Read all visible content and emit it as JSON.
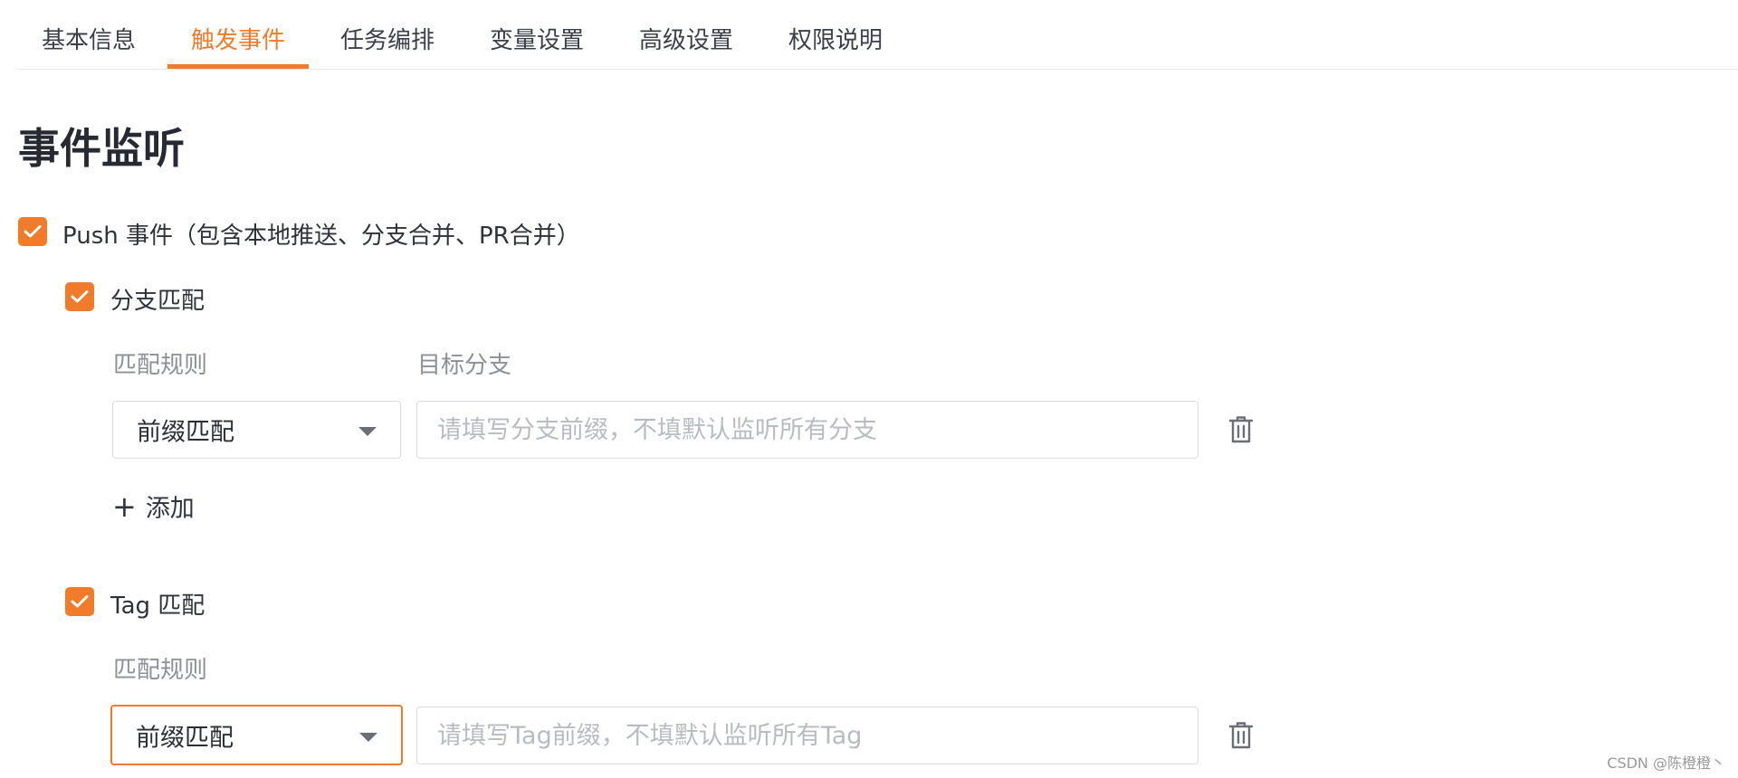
{
  "tabs": [
    {
      "label": "基本信息",
      "active": false
    },
    {
      "label": "触发事件",
      "active": true
    },
    {
      "label": "任务编排",
      "active": false
    },
    {
      "label": "变量设置",
      "active": false
    },
    {
      "label": "高级设置",
      "active": false
    },
    {
      "label": "权限说明",
      "active": false
    }
  ],
  "page_title": "事件监听",
  "push_event": {
    "checked": true,
    "label": "Push 事件（包含本地推送、分支合并、PR合并）"
  },
  "branch_match": {
    "checked": true,
    "label": "分支匹配",
    "rule_label": "匹配规则",
    "target_label": "目标分支",
    "rule_value": "前缀匹配",
    "input_value": "",
    "input_placeholder": "请填写分支前缀，不填默认监听所有分支",
    "add_label": "添加"
  },
  "tag_match": {
    "checked": true,
    "label": "Tag 匹配",
    "rule_label": "匹配规则",
    "rule_value": "前缀匹配",
    "input_value": "",
    "input_placeholder": "请填写Tag前缀，不填默认监听所有Tag"
  },
  "watermark": "CSDN @陈橙橙丶",
  "colors": {
    "accent": "#f07b2b",
    "border": "#d9dbe0",
    "muted_text": "#8c9098",
    "placeholder": "#b8bbc1"
  },
  "icons": {
    "checkbox": "check-icon",
    "dropdown": "chevron-down-icon",
    "delete": "trash-icon",
    "add": "plus-icon"
  }
}
